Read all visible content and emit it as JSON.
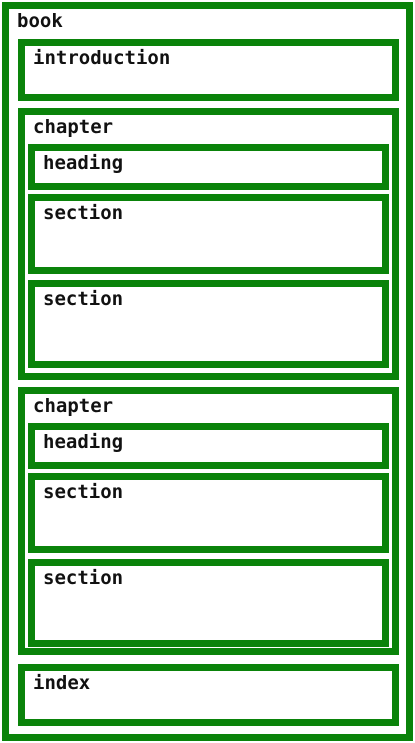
{
  "diagram": {
    "accent_color": "#0a830a",
    "book": {
      "label": "book",
      "introduction": {
        "label": "introduction"
      },
      "chapters": [
        {
          "label": "chapter",
          "heading": {
            "label": "heading"
          },
          "sections": [
            {
              "label": "section"
            },
            {
              "label": "section"
            }
          ]
        },
        {
          "label": "chapter",
          "heading": {
            "label": "heading"
          },
          "sections": [
            {
              "label": "section"
            },
            {
              "label": "section"
            }
          ]
        }
      ],
      "index": {
        "label": "index"
      }
    }
  }
}
